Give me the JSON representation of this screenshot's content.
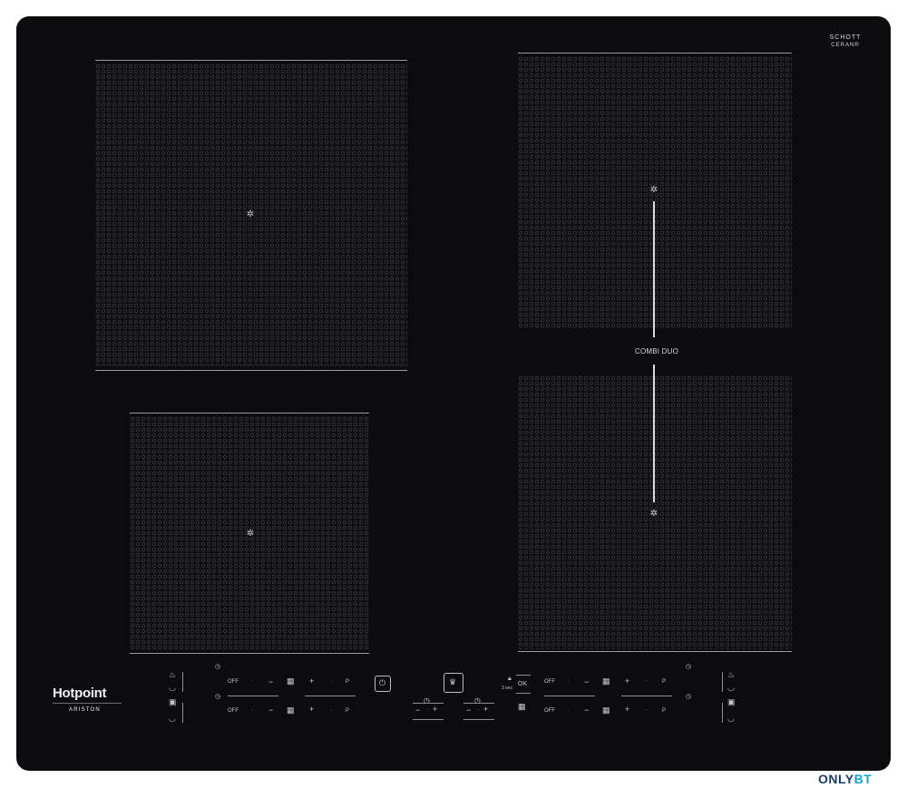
{
  "schott": {
    "line1": "SCHOTT",
    "line2": "CERAN®"
  },
  "combi_label": "COMBI DUO",
  "brand": {
    "name": "Hotpoint",
    "sub": "ARISTON"
  },
  "controls": {
    "off": "OFF",
    "minus": "−",
    "plus": "+",
    "dot": "·",
    "p": "P",
    "ok": "OK",
    "sec": "3 sec"
  },
  "watermark": {
    "only": "ONLY",
    "bt": "BT",
    "only_color": "#1c3c63",
    "bt_color": "#1aa3c8"
  }
}
